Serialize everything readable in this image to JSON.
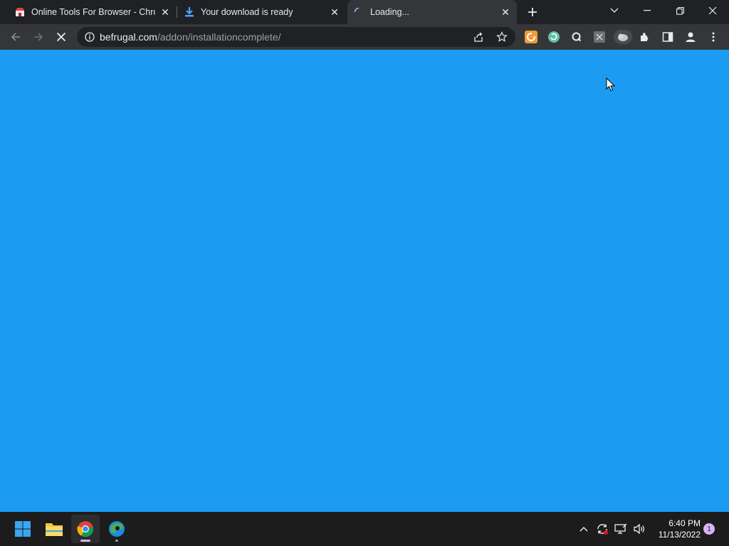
{
  "tabs": [
    {
      "title": "Online Tools For Browser - Chrom",
      "favicon": "store-icon",
      "active": false
    },
    {
      "title": "Your download is ready",
      "favicon": "download-icon",
      "active": false
    },
    {
      "title": "Loading...",
      "favicon": "loading-spinner-icon",
      "active": true
    }
  ],
  "toolbar": {
    "url_host": "befrugal.com",
    "url_path": "/addon/installationcomplete/"
  },
  "content": {
    "background": "#1b9cf2"
  },
  "taskbar": {
    "time": "6:40 PM",
    "date": "11/13/2022",
    "notification_count": "1"
  },
  "colors": {
    "chrome_dark": "#202124",
    "chrome_toolbar": "#35363a",
    "page_blue": "#1b9cf2",
    "taskbar": "#1c1c1c"
  }
}
